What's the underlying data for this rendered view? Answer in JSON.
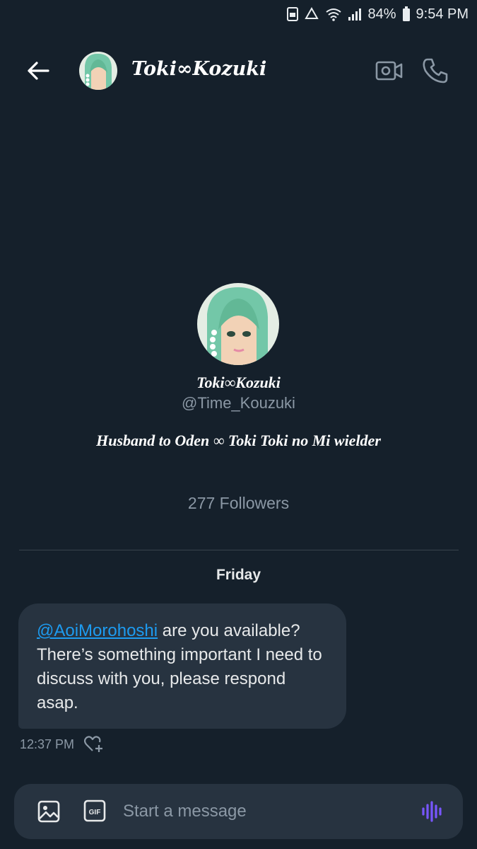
{
  "status_bar": {
    "battery": "84%",
    "time": "9:54 PM",
    "icons": [
      "save-icon",
      "recycle-icon",
      "wifi-icon",
      "signal-icon",
      "battery-icon"
    ]
  },
  "header": {
    "back_icon": "arrow-left-icon",
    "name": "Toki∞Kozuki",
    "actions": [
      "video-call-icon",
      "phone-icon"
    ]
  },
  "profile": {
    "name": "Toki∞Kozuki",
    "handle": "@Time_Kouzuki",
    "bio": "Husband to Oden ∞ Toki Toki no Mi wielder",
    "followers": "277 Followers"
  },
  "conversation": {
    "day_label": "Friday",
    "messages": [
      {
        "mention": "@AoiMorohoshi",
        "text": " are you available? There’s something important I need to discuss with you, please respond asap.",
        "time": "12:37 PM"
      }
    ]
  },
  "composer": {
    "placeholder": "Start a message",
    "image_icon": "image-icon",
    "gif_label": "GIF",
    "voice_icon": "voice-wave-icon"
  },
  "colors": {
    "background": "#15202b",
    "bubble": "#273340",
    "accent": "#1d9bf0",
    "muted": "#8b98a5",
    "voice": "#7856ff"
  }
}
